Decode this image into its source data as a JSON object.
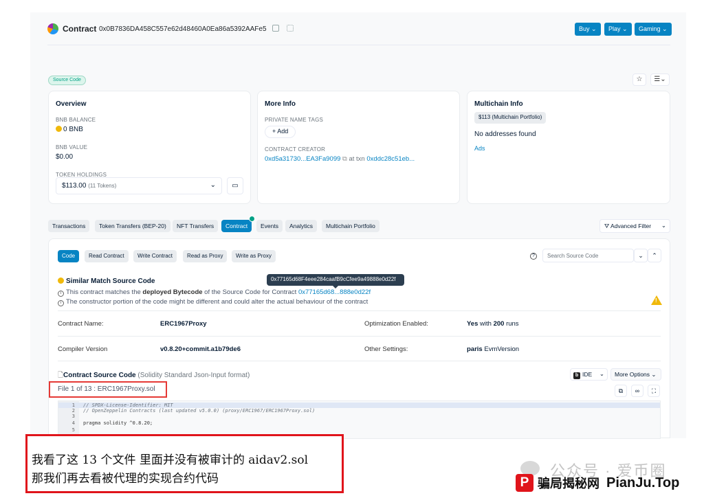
{
  "header": {
    "title": "Contract",
    "address": "0x0B7836DA458C557e62d48460A0Ea86a5392AAFe5",
    "buttons": [
      "Buy",
      "Play",
      "Gaming"
    ]
  },
  "source_badge": "Source Code",
  "overview": {
    "title": "Overview",
    "bnb_balance_label": "BNB BALANCE",
    "bnb_balance": "0 BNB",
    "bnb_value_label": "BNB VALUE",
    "bnb_value": "$0.00",
    "token_holdings_label": "TOKEN HOLDINGS",
    "token_holdings": "$113.00",
    "token_count": "(11 Tokens)"
  },
  "more_info": {
    "title": "More Info",
    "private_tags_label": "PRIVATE NAME TAGS",
    "add_label": "+ Add",
    "creator_label": "CONTRACT CREATOR",
    "creator": "0xd5a31730...EA3Fa9099",
    "at_txn": "at txn",
    "txn": "0xddc28c51eb..."
  },
  "multichain": {
    "title": "Multichain Info",
    "portfolio": "$113 (Multichain Portfolio)",
    "no_addresses": "No addresses found",
    "ads": "Ads"
  },
  "tabs": [
    "Transactions",
    "Token Transfers (BEP-20)",
    "NFT Transfers",
    "Contract",
    "Events",
    "Analytics",
    "Multichain Portfolio"
  ],
  "advanced_filter": "Advanced Filter",
  "subtabs": [
    "Code",
    "Read Contract",
    "Write Contract",
    "Read as Proxy",
    "Write as Proxy"
  ],
  "search_placeholder": "Search Source Code",
  "tooltip": "0x77165d68F4eee284caafB9cCfee9a49888e0d22f",
  "similar": {
    "title": "Similar Match Source Code",
    "line1_a": "This contract matches the",
    "line1_b": "deployed Bytecode",
    "line1_c": "of the Source Code for Contract",
    "line1_link": "0x77165d68...888e0d22f",
    "line2": "The constructor portion of the code might be different and could alter the actual behaviour of the contract"
  },
  "details": {
    "contract_name_label": "Contract Name:",
    "contract_name": "ERC1967Proxy",
    "optimization_label": "Optimization Enabled:",
    "optimization_yes": "Yes",
    "optimization_with": "with",
    "optimization_runs": "200",
    "optimization_runs_word": "runs",
    "compiler_label": "Compiler Version",
    "compiler": "v0.8.20+commit.a1b79de6",
    "other_label": "Other Settings:",
    "other_evm": "paris",
    "other_suffix": "EvmVersion"
  },
  "source": {
    "title": "Contract Source Code",
    "sub_prefix": "(Solidity",
    "sub_link": "Standard Json-Input",
    "sub_suffix": "format)",
    "file_label": "File 1 of 13 : ERC1967Proxy.sol",
    "ide": "IDE",
    "more_options": "More Options"
  },
  "code_lines": [
    {
      "n": "1",
      "t": "// SPDX-License-Identifier: MIT"
    },
    {
      "n": "2",
      "t": "// OpenZeppelin Contracts (last updated v5.0.0) (proxy/ERC1967/ERC1967Proxy.sol)"
    },
    {
      "n": "3",
      "t": ""
    },
    {
      "n": "4",
      "t": "pragma solidity ^0.8.20;"
    },
    {
      "n": "5",
      "t": ""
    }
  ],
  "caption": {
    "line1": "我看了这 13 个文件  里面并没有被审计的 aidav2.sol",
    "line2": "那我们再去看被代理的实现合约代码"
  },
  "watermark": {
    "line1": "公众号 · 爱币圈",
    "brand_cn": "骗局揭秘网",
    "brand_en": "PianJu.Top",
    "brand_letter": "P"
  }
}
